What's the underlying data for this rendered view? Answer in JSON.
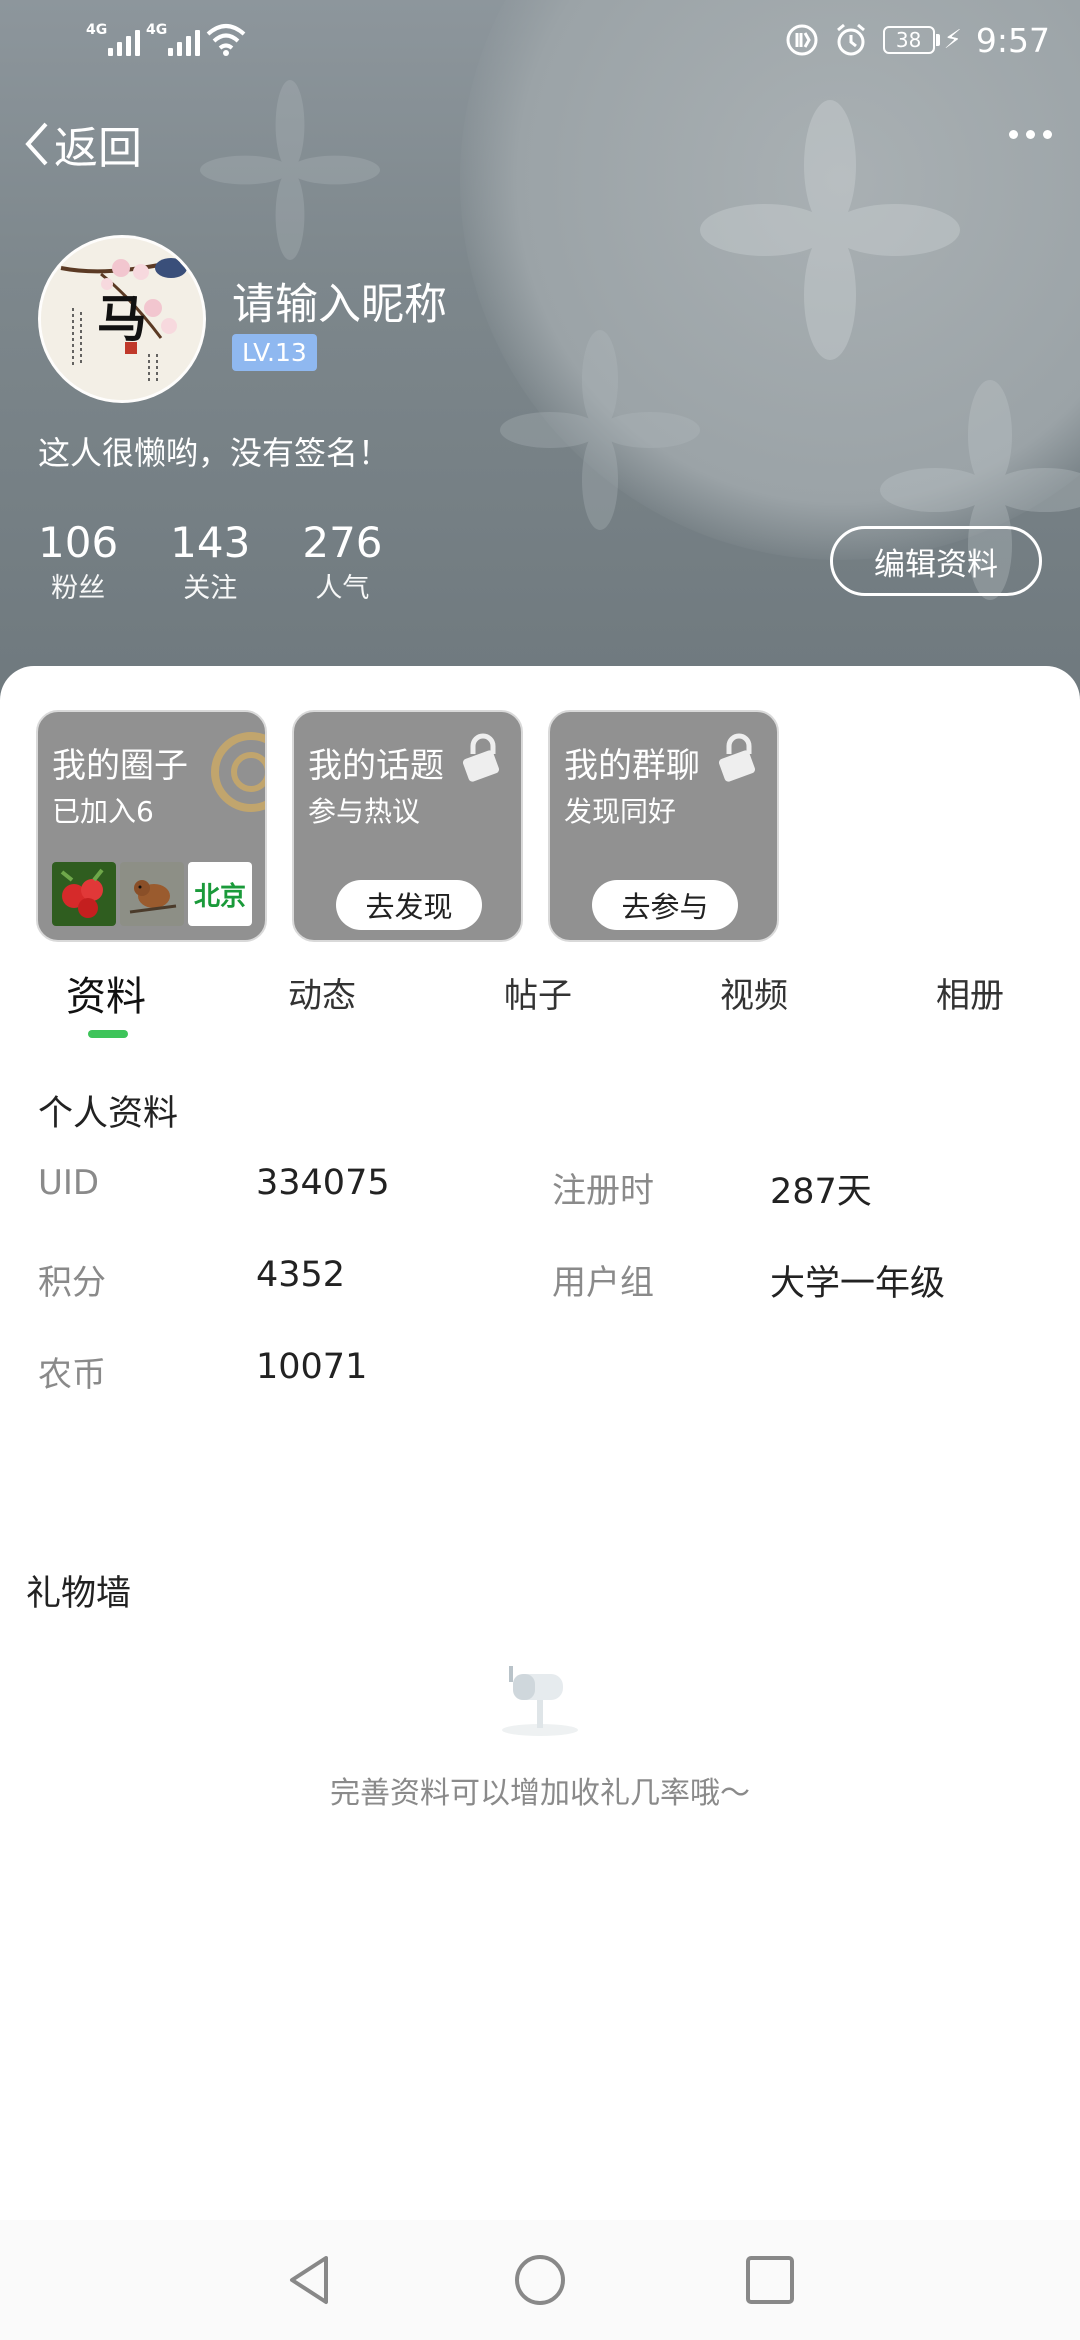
{
  "status_bar": {
    "signal1": "4G",
    "signal2": "4G",
    "battery": "38",
    "time": "9:57"
  },
  "nav": {
    "back_label": "返回"
  },
  "profile": {
    "nickname": "请输入昵称",
    "level": "LV.13",
    "signature": "这人很懒哟，没有签名！",
    "edit_label": "编辑资料",
    "stats": [
      {
        "value": "106",
        "label": "粉丝"
      },
      {
        "value": "143",
        "label": "关注"
      },
      {
        "value": "276",
        "label": "人气"
      }
    ],
    "avatar_char": "马"
  },
  "cards": [
    {
      "title": "我的圈子",
      "sub": "已加入6",
      "thumb3": "北京"
    },
    {
      "title": "我的话题",
      "sub": "参与热议",
      "button": "去发现"
    },
    {
      "title": "我的群聊",
      "sub": "发现同好",
      "button": "去参与"
    }
  ],
  "tabs": [
    "资料",
    "动态",
    "帖子",
    "视频",
    "相册"
  ],
  "personal_info": {
    "title": "个人资料",
    "fields": [
      {
        "label": "UID",
        "value": "334075"
      },
      {
        "label": "注册时",
        "value": "287天"
      },
      {
        "label": "积分",
        "value": "4352"
      },
      {
        "label": "用户组",
        "value": "大学一年级"
      },
      {
        "label": "农币",
        "value": "10071"
      }
    ]
  },
  "gift_wall": {
    "title": "礼物墙",
    "empty_tip": "完善资料可以增加收礼几率哦～"
  },
  "colors": {
    "accent": "#3ec45a",
    "level_badge": "#8fb8f0",
    "card_bg": "#919191"
  }
}
